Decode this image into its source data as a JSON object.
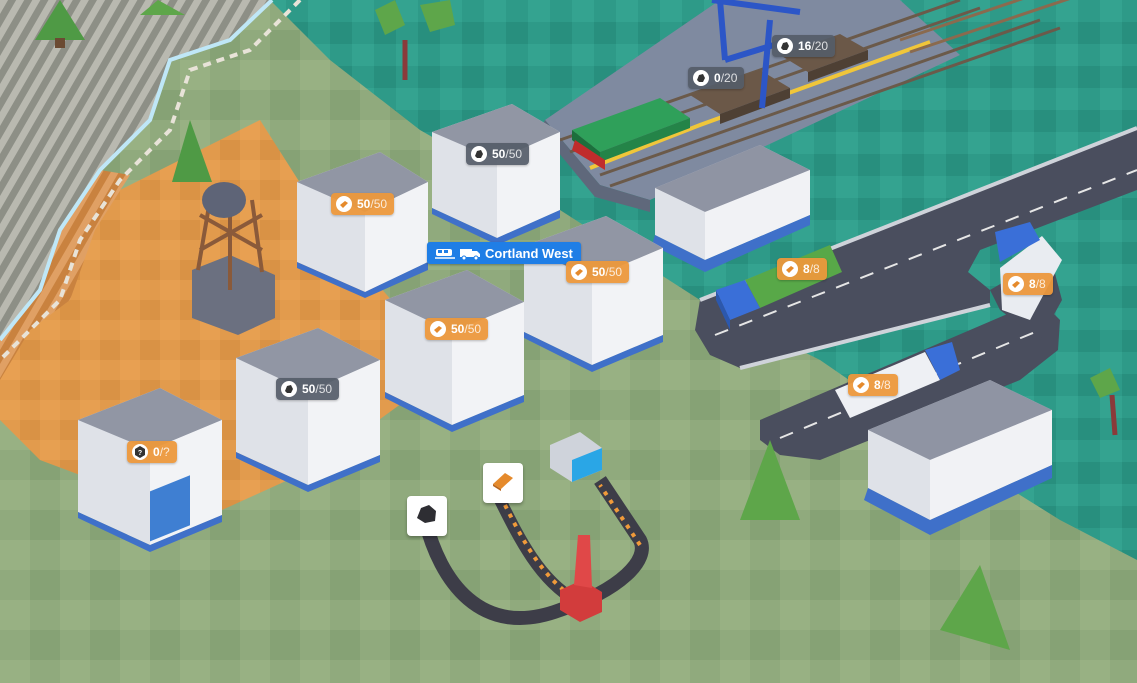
{
  "station": {
    "name": "Cortland West"
  },
  "warehouses": [
    {
      "resource": "coal",
      "amount": "50",
      "capacity": "/50"
    },
    {
      "resource": "wood",
      "amount": "50",
      "capacity": "/50"
    },
    {
      "resource": "wood",
      "amount": "50",
      "capacity": "/50"
    },
    {
      "resource": "wood",
      "amount": "50",
      "capacity": "/50"
    },
    {
      "resource": "coal",
      "amount": "50",
      "capacity": "/50"
    },
    {
      "resource": "unknown",
      "amount": "0",
      "capacity": "/?"
    }
  ],
  "wagons": [
    {
      "resource": "coal",
      "amount": "16",
      "capacity": "/20"
    },
    {
      "resource": "coal",
      "amount": "0",
      "capacity": "/20"
    }
  ],
  "trucks": [
    {
      "resource": "wood",
      "amount": "8",
      "capacity": "/8"
    },
    {
      "resource": "wood",
      "amount": "8",
      "capacity": "/8"
    },
    {
      "resource": "wood",
      "amount": "8",
      "capacity": "/8"
    }
  ],
  "factory_inputs": [
    {
      "resource": "coal"
    },
    {
      "resource": "wood"
    }
  ],
  "colors": {
    "coal_chip": "#555c68",
    "wood_chip": "#ec983c",
    "station_label": "#1f7ee6",
    "grass": "#8fa97c",
    "water": "#2f9a88",
    "orange_zone": "#e69a4a"
  }
}
